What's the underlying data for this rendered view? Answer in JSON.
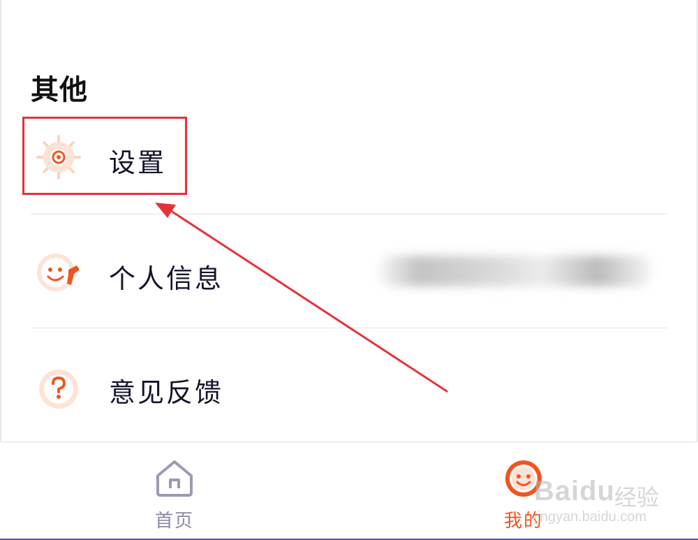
{
  "section": {
    "title": "其他"
  },
  "menu": {
    "items": [
      {
        "label": "设置",
        "icon": "gear-icon"
      },
      {
        "label": "个人信息",
        "icon": "profile-wrench-icon"
      },
      {
        "label": "意见反馈",
        "icon": "question-feedback-icon"
      }
    ]
  },
  "tabbar": {
    "tabs": [
      {
        "label": "首页",
        "icon": "home-icon",
        "active": false
      },
      {
        "label": "我的",
        "icon": "smile-icon",
        "active": true
      }
    ]
  },
  "watermark": {
    "logo": "Baidu",
    "cn": "经验",
    "url": "jingyan.baidu.com"
  },
  "colors": {
    "accent": "#f0551f",
    "icon_light": "#fcd3bf",
    "highlight": "#e8303a",
    "inactive": "#8a8aa0"
  }
}
